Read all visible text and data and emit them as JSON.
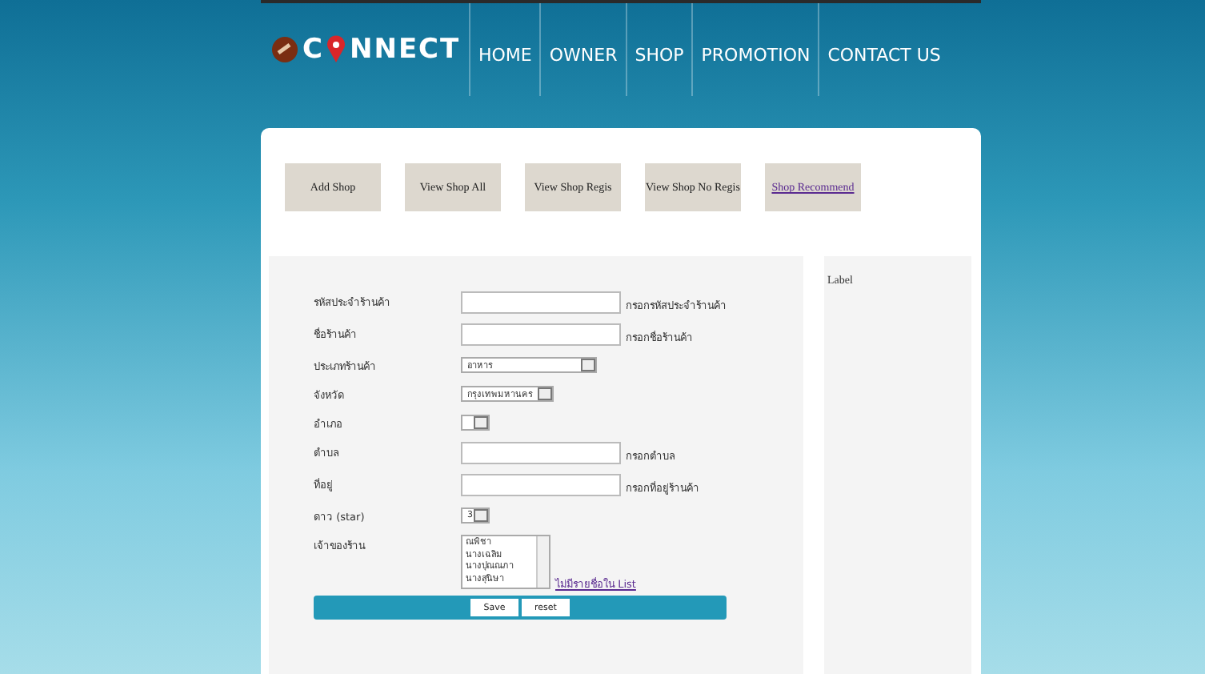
{
  "header": {
    "logo": {
      "left": "C",
      "right": "NNECT"
    },
    "nav": [
      {
        "label": "HOME"
      },
      {
        "label": "OWNER"
      },
      {
        "label": "SHOP"
      },
      {
        "label": "PROMOTION"
      },
      {
        "label": "CONTACT US"
      }
    ]
  },
  "tabs": [
    {
      "label": "Add Shop",
      "kind": "button"
    },
    {
      "label": "View Shop All",
      "kind": "button"
    },
    {
      "label": "View Shop Regis",
      "kind": "button"
    },
    {
      "label": "View Shop No Regis",
      "kind": "button"
    },
    {
      "label": "Shop Recommend",
      "kind": "link"
    }
  ],
  "form": {
    "fields": [
      {
        "kind": "text",
        "label": "รหัสประจำร้านค้า",
        "hint": "กรอกรหัสประจำร้านค้า"
      },
      {
        "kind": "text",
        "label": "ชื่อร้านค้า",
        "hint": "กรอกชื่อร้านค้า"
      },
      {
        "kind": "select",
        "label": "ประเภทร้านค้า",
        "value": "อาหาร"
      },
      {
        "kind": "select",
        "label": "จังหวัด",
        "value": "กรุงเทพมหานคร"
      },
      {
        "kind": "select",
        "label": "อำเภอ"
      },
      {
        "kind": "text",
        "label": "ตำบล",
        "hint": "กรอกตำบล"
      },
      {
        "kind": "text",
        "label": "ที่อยู่",
        "hint": "กรอกที่อยู่ร้านค้า"
      },
      {
        "kind": "select",
        "label": "ดาว (star)",
        "value": "3"
      },
      {
        "kind": "listbox",
        "label": "เจ้าของร้าน",
        "options": [
          "ณพิชา",
          "นางเฉลิม",
          "นางปุณณภา",
          "นางสุนิษา"
        ],
        "link": "ไม่มีรายชื่อใน List"
      }
    ],
    "buttons": [
      "Save",
      "reset"
    ]
  },
  "side": {
    "label": "Label"
  }
}
